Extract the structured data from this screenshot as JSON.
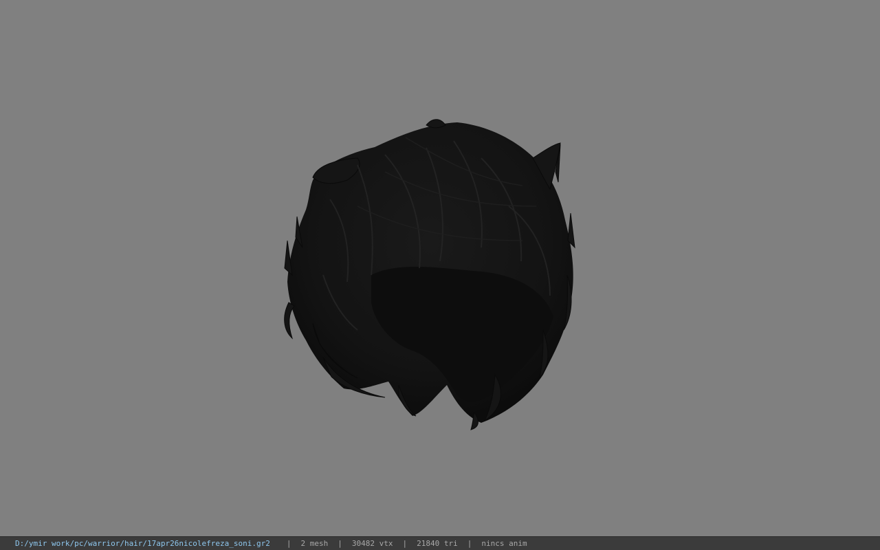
{
  "status_bar": {
    "file_path": "D:/ymir work/pc/warrior/hair/17apr26nicolefreza_soni.gr2",
    "separator": "|",
    "mesh_count": "2 mesh",
    "vertex_count": "30482 vtx",
    "triangle_count": "21840 tri",
    "animation": "nincs anim"
  },
  "viewport": {
    "background_color": "#808080",
    "model_color": "#141414"
  },
  "colors": {
    "path_text": "#8ec7ee",
    "status_text": "#a8a8a8",
    "status_bg": "#3b3b3b"
  }
}
